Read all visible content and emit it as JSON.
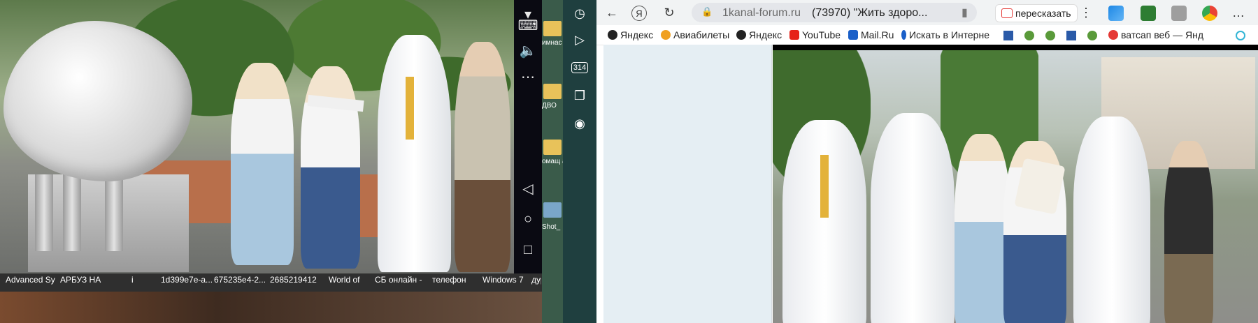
{
  "left_desktop": {
    "icon_labels": [
      "Advanced Sy",
      "АРБУЗ НА",
      "i",
      "1d399e7e-a...",
      "675235e4-2...",
      "2685219412",
      "World of",
      "СБ онлайн -",
      "телефон",
      "Windows 7",
      "дура Ра"
    ],
    "strip_labels": [
      "имнас для ш",
      "ДВО",
      "омащ атро",
      "Shot_"
    ]
  },
  "side_panel": {
    "badge": "314"
  },
  "browser": {
    "domain": "1kanal-forum.ru",
    "page_title": "(73970) \"Жить здоро...",
    "summarize_label": "пересказать",
    "bookmarks": [
      {
        "label": "Яндекс",
        "color": "#222222"
      },
      {
        "label": "Авиабилеты",
        "color": "#f0a020"
      },
      {
        "label": "Яндекс",
        "color": "#222222"
      },
      {
        "label": "YouTube",
        "color": "#e62117"
      },
      {
        "label": "Mail.Ru",
        "color": "#1a5fc8"
      },
      {
        "label": "Искать в Интерне",
        "color": "#1a5fc8"
      },
      {
        "label": "ватсап веб — Янд",
        "color": "#e53935"
      }
    ]
  }
}
